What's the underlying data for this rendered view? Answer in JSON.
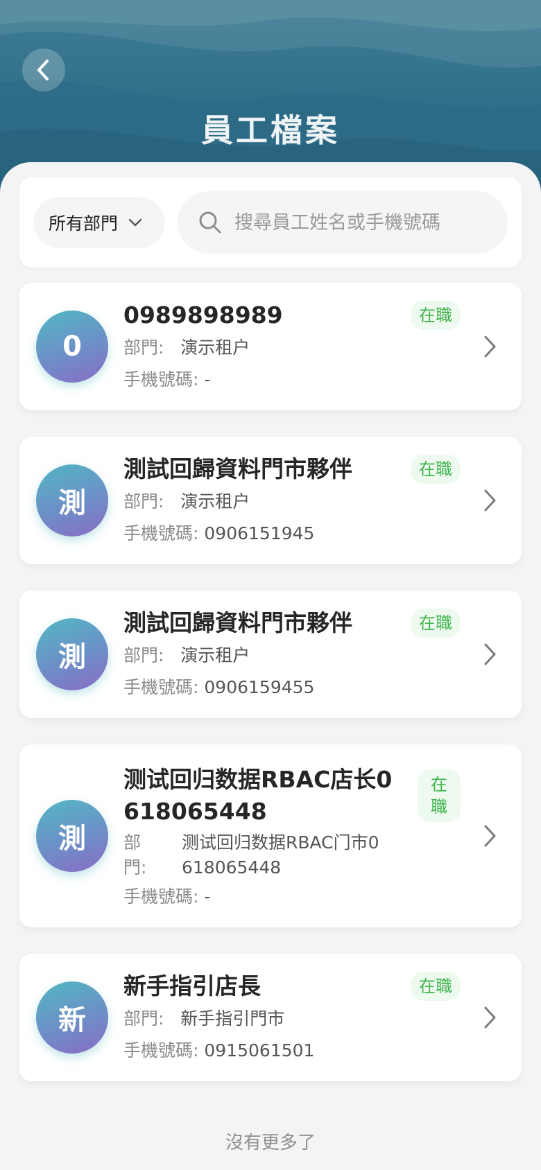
{
  "header": {
    "title": "員工檔案",
    "back_icon": "chevron-left-icon"
  },
  "filters": {
    "department_select": "所有部門",
    "search_placeholder": "搜尋員工姓名或手機號碼"
  },
  "labels": {
    "department": "部門:",
    "phone": "手機號碼:"
  },
  "employees": [
    {
      "initial": "0",
      "name": "0989898989",
      "status": "在職",
      "department": "演示租户",
      "phone": "-"
    },
    {
      "initial": "測",
      "name": "測試回歸資料門市夥伴",
      "status": "在職",
      "department": "演示租户",
      "phone": "0906151945"
    },
    {
      "initial": "測",
      "name": "測試回歸資料門市夥伴",
      "status": "在職",
      "department": "演示租户",
      "phone": "0906159455"
    },
    {
      "initial": "測",
      "name": "测试回归数据RBAC店长0618065448",
      "status": "在職",
      "department": "测试回归数据RBAC门市0618065448",
      "phone": "-"
    },
    {
      "initial": "新",
      "name": "新手指引店長",
      "status": "在職",
      "department": "新手指引門市",
      "phone": "0915061501"
    }
  ],
  "footer": "沒有更多了",
  "colors": {
    "header_bg": "#2f6e88",
    "status_green": "#3fb44c",
    "avatar_gradient_start": "#52b8c4",
    "avatar_gradient_end": "#8a6cc6"
  }
}
